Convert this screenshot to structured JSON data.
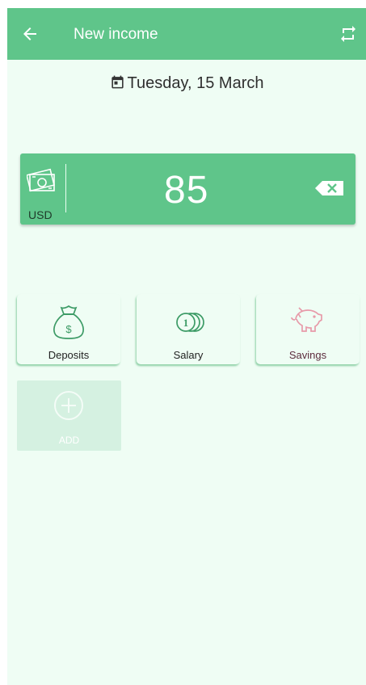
{
  "header": {
    "title": "New income",
    "back_icon": "arrow-left-icon",
    "action_icon": "repeat-icon",
    "color": "#5fc58a"
  },
  "date": {
    "icon": "calendar-icon",
    "label": "Tuesday, 15 March"
  },
  "amount": {
    "currency": "USD",
    "value": "85",
    "currency_icon": "banknote-icon",
    "clear_icon": "backspace-icon"
  },
  "categories": [
    {
      "label": "Deposits",
      "icon": "money-bag-icon",
      "color": "#3d9b66"
    },
    {
      "label": "Salary",
      "icon": "coins-icon",
      "color": "#3d9b66"
    },
    {
      "label": "Savings",
      "icon": "piggy-bank-icon",
      "color": "#e79aa9"
    }
  ],
  "add_button": {
    "label": "ADD",
    "icon": "plus-circle-icon"
  }
}
